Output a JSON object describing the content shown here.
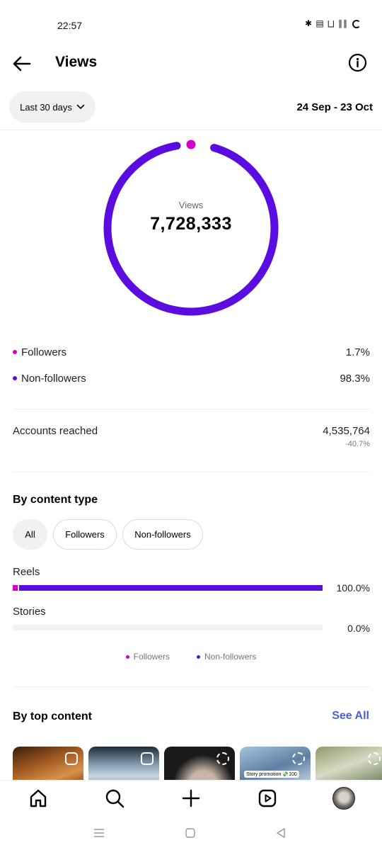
{
  "status_bar": {
    "time": "22:57",
    "icons": [
      "bluetooth-icon",
      "volte-icon",
      "wifi-icon",
      "signal-icon",
      "battery-icon"
    ],
    "icons_text": "✱ ▤ ⨆ ∥∥"
  },
  "header": {
    "title": "Views"
  },
  "range": {
    "selected": "Last 30 days",
    "dates": "24 Sep - 23 Oct"
  },
  "summary": {
    "label": "Views",
    "total": "7,728,333",
    "followers_pct_value": 1.7,
    "colors": {
      "followers": "#d300c5",
      "non_followers": "#5b0ce0"
    }
  },
  "legend": [
    {
      "label": "Followers",
      "pct": "1.7%"
    },
    {
      "label": "Non-followers",
      "pct": "98.3%"
    }
  ],
  "reach": {
    "label": "Accounts reached",
    "value": "4,535,764",
    "change": "-40.7%"
  },
  "by_content_type": {
    "title": "By content type",
    "filters": [
      "All",
      "Followers",
      "Non-followers"
    ],
    "active_filter": "All",
    "rows": [
      {
        "label": "Reels",
        "pct": "100.0%",
        "value": 100,
        "followers_share": 1.7
      },
      {
        "label": "Stories",
        "pct": "0.0%",
        "value": 0,
        "followers_share": 0
      }
    ],
    "legend": [
      "Followers",
      "Non-followers"
    ]
  },
  "by_top_content": {
    "title": "By top content",
    "see_all": "See All",
    "thumbnails": [
      {
        "type": "reel",
        "caption": ""
      },
      {
        "type": "reel",
        "caption": ""
      },
      {
        "type": "story",
        "caption": ""
      },
      {
        "type": "story",
        "caption": "Story promotion 💸100"
      },
      {
        "type": "story",
        "caption": ""
      }
    ]
  },
  "bottom_nav": [
    "home-icon",
    "search-icon",
    "create-icon",
    "reels-icon",
    "profile-avatar"
  ],
  "system_nav": [
    "menu-icon",
    "home-square-icon",
    "back-triangle-icon"
  ]
}
